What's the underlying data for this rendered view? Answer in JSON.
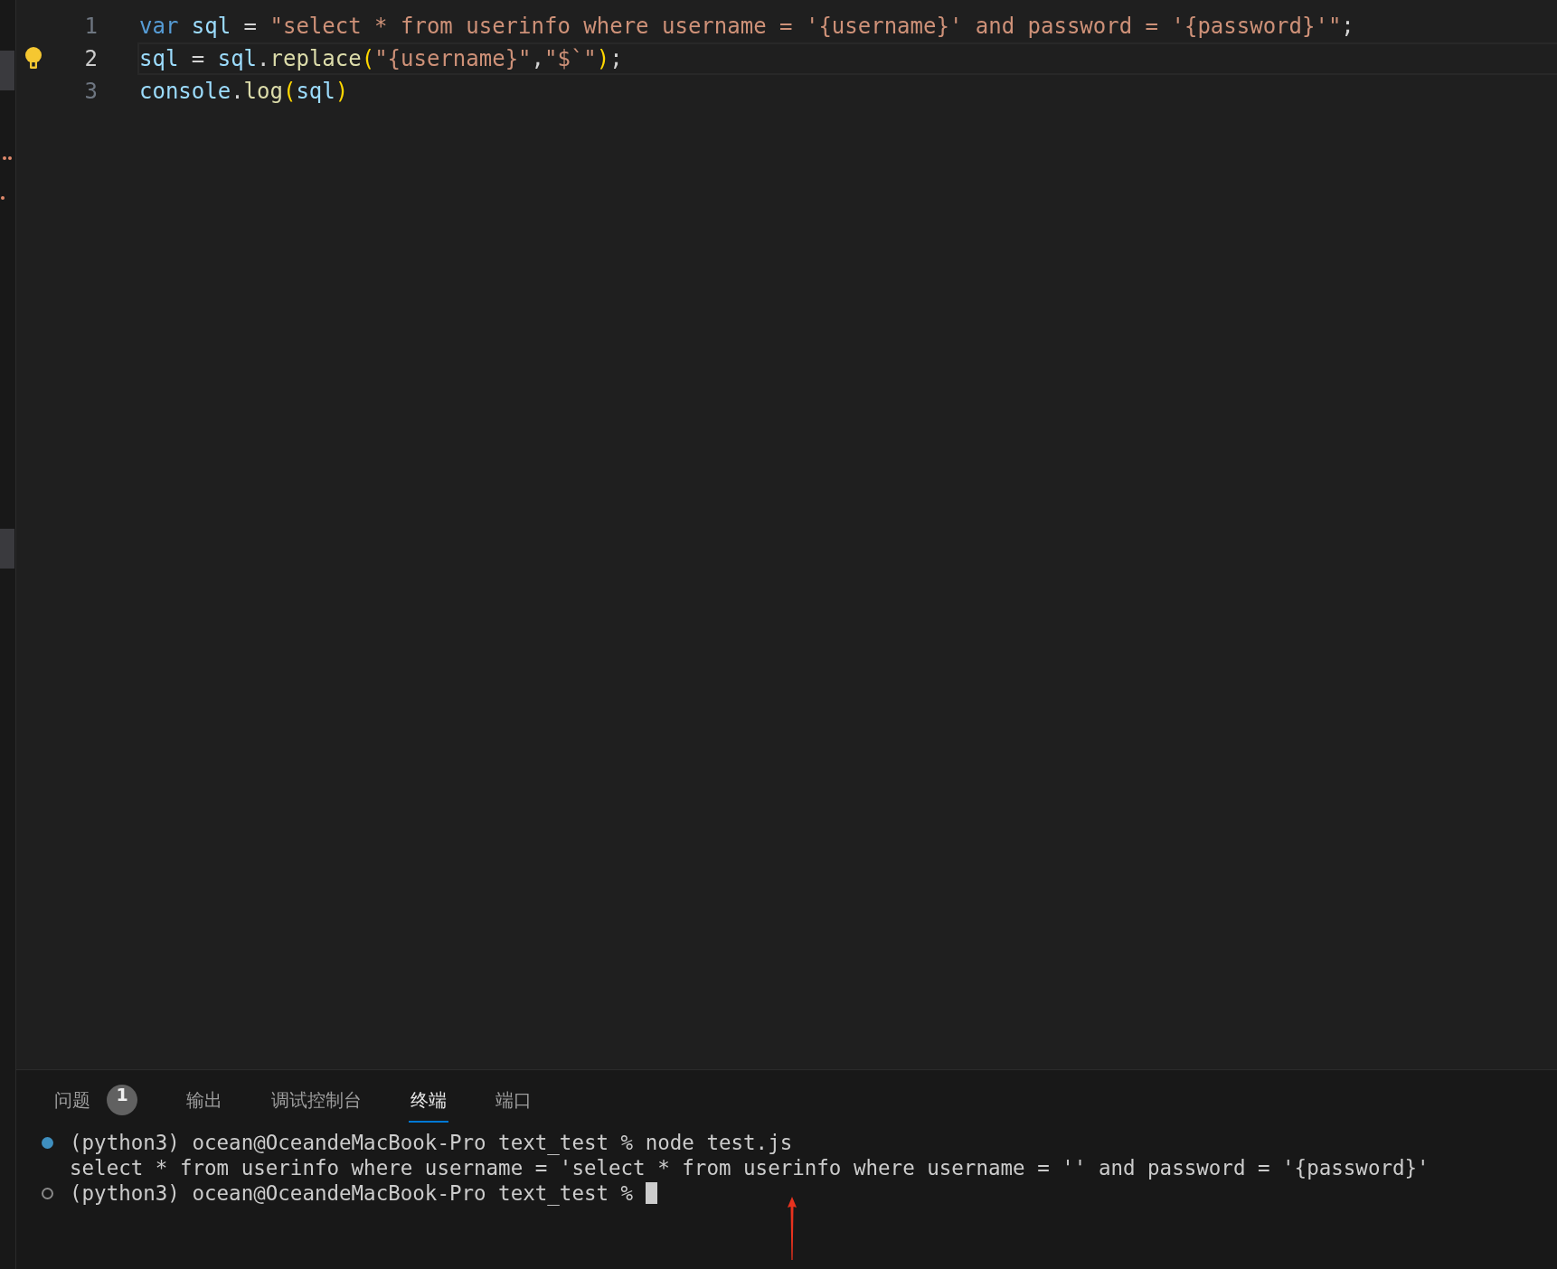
{
  "editor": {
    "lines": [
      {
        "number": "1",
        "current": false,
        "lightbulb": false,
        "tokens": [
          {
            "kind": "keyword",
            "text": "var"
          },
          {
            "kind": "variable",
            "text": " sql"
          },
          {
            "kind": "plain",
            "text": " = "
          },
          {
            "kind": "string",
            "text": "\"select * from userinfo where username = '{username}' and password = '{password}'\""
          },
          {
            "kind": "plain",
            "text": ";"
          }
        ]
      },
      {
        "number": "2",
        "current": true,
        "lightbulb": true,
        "tokens": [
          {
            "kind": "variable",
            "text": "sql"
          },
          {
            "kind": "plain",
            "text": " = "
          },
          {
            "kind": "variable",
            "text": "sql"
          },
          {
            "kind": "plain",
            "text": "."
          },
          {
            "kind": "function",
            "text": "replace"
          },
          {
            "kind": "bracket",
            "text": "("
          },
          {
            "kind": "string",
            "text": "\"{username}\""
          },
          {
            "kind": "plain",
            "text": ","
          },
          {
            "kind": "string",
            "text": "\"$`\""
          },
          {
            "kind": "bracket",
            "text": ")"
          },
          {
            "kind": "plain",
            "text": ";"
          }
        ]
      },
      {
        "number": "3",
        "current": false,
        "lightbulb": false,
        "tokens": [
          {
            "kind": "variable",
            "text": "console"
          },
          {
            "kind": "plain",
            "text": "."
          },
          {
            "kind": "function",
            "text": "log"
          },
          {
            "kind": "bracket",
            "text": "("
          },
          {
            "kind": "variable",
            "text": "sql"
          },
          {
            "kind": "bracket",
            "text": ")"
          }
        ]
      }
    ]
  },
  "panel": {
    "tabs": [
      {
        "label": "问题",
        "selected": false,
        "badge": "1"
      },
      {
        "label": "输出",
        "selected": false
      },
      {
        "label": "调试控制台",
        "selected": false
      },
      {
        "label": "终端",
        "selected": true
      },
      {
        "label": "端口",
        "selected": false
      }
    ],
    "terminal": [
      {
        "kind": "command",
        "text": "(python3) ocean@OceandeMacBook-Pro text_test % node test.js"
      },
      {
        "kind": "output",
        "text": "select * from userinfo where username = 'select * from userinfo where username = '' and password = '{password}'"
      },
      {
        "kind": "prompt",
        "text": "(python3) ocean@OceandeMacBook-Pro text_test %"
      }
    ]
  }
}
